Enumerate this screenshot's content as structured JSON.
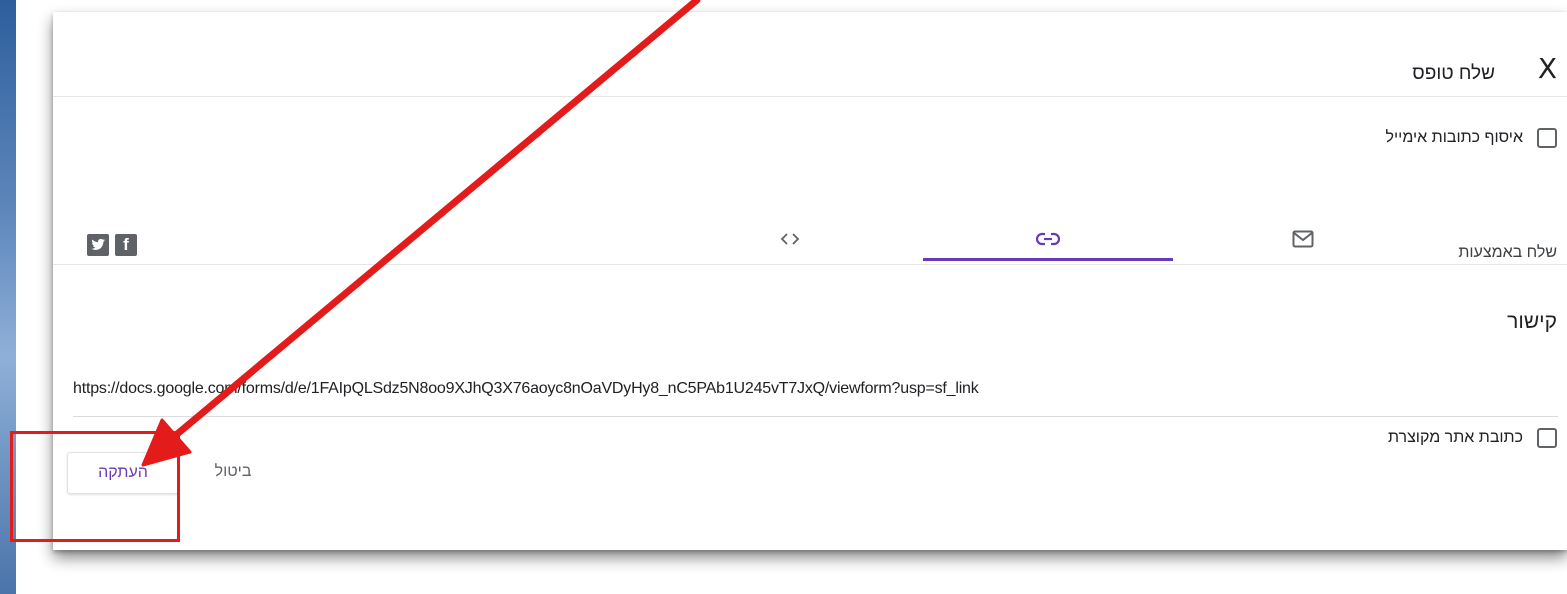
{
  "dialog": {
    "title": "שלח טופס",
    "close_label": "X",
    "collect_emails_label": "איסוף כתובות אימייל",
    "send_via_label": "שלח באמצעות",
    "tabs": [
      {
        "icon": "envelope-icon",
        "active": false
      },
      {
        "icon": "link-icon",
        "active": true
      },
      {
        "icon": "code-embed-icon",
        "active": false
      }
    ],
    "social": {
      "facebook_glyph": "f",
      "twitter_glyph": "t"
    },
    "link_section": {
      "title": "קישור",
      "url": "https://docs.google.com/forms/d/e/1FAIpQLSdz5N8oo9XJhQ3X76aoyc8nOaVDyHy8_nC5PAb1U245vT7JxQ/viewform?usp=sf_link",
      "shorten_label": "כתובת אתר מקוצרת"
    },
    "buttons": {
      "copy": "העתקה",
      "cancel": "ביטול"
    }
  },
  "colors": {
    "accent": "#673ab7",
    "annotation": "#e31b1b"
  }
}
